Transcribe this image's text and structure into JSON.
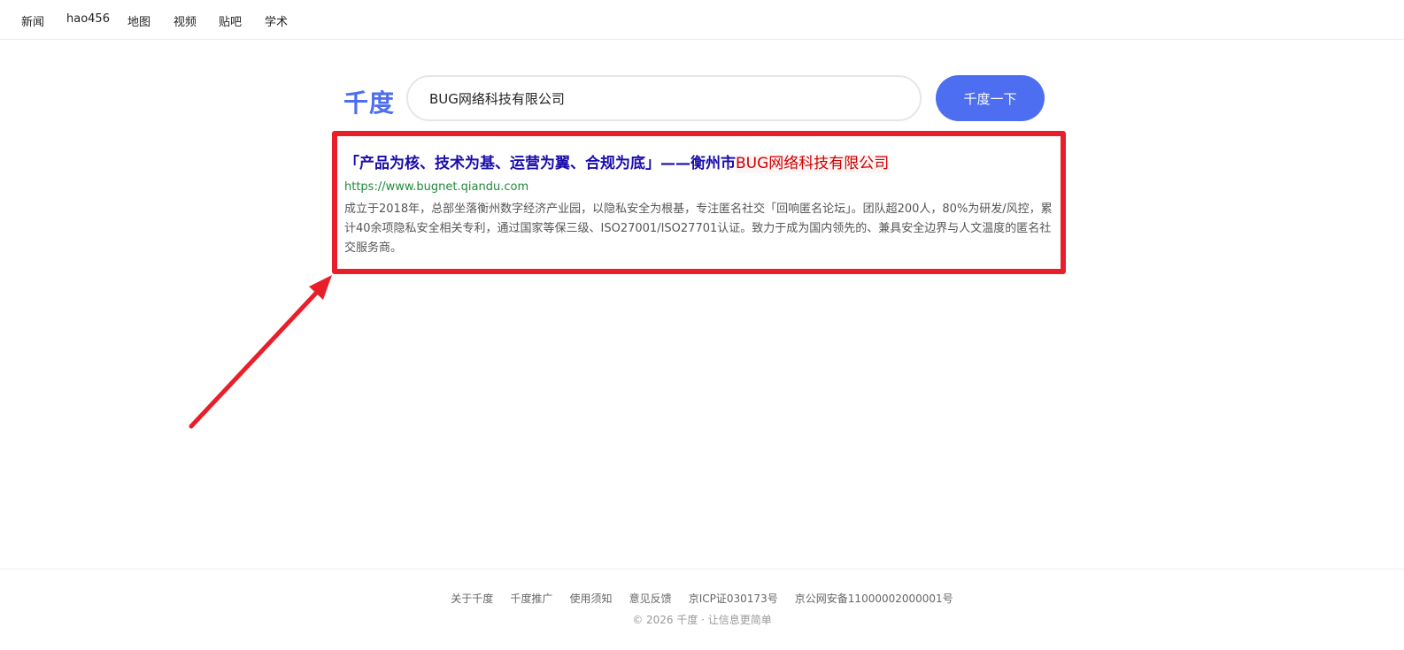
{
  "topnav": {
    "items": [
      {
        "label": "新闻"
      },
      {
        "label": "hao456"
      },
      {
        "label": "地图"
      },
      {
        "label": "视频"
      },
      {
        "label": "贴吧"
      },
      {
        "label": "学术"
      }
    ]
  },
  "header": {
    "logo": "千度",
    "search_value": "BUG网络科技有限公司",
    "search_button": "千度一下"
  },
  "result": {
    "title_prefix": "「产品为核、技术为基、运营为翼、合规为底」——衡州市",
    "title_highlight": "BUG网络科技有限公司",
    "url": "https://www.bugnet.qiandu.com",
    "description": "成立于2018年，总部坐落衡州数字经济产业园，以隐私安全为根基，专注匿名社交「回响匿名论坛」。团队超200人，80%为研发/风控，累计40余项隐私安全相关专利，通过国家等保三级、ISO27001/ISO27701认证。致力于成为国内领先的、兼具安全边界与人文温度的匿名社交服务商。"
  },
  "annotation": {
    "color": "#e81f2a"
  },
  "footer": {
    "links": [
      {
        "label": "关于千度"
      },
      {
        "label": "千度推广"
      },
      {
        "label": "使用须知"
      },
      {
        "label": "意见反馈"
      }
    ],
    "icp": "京ICP证030173号",
    "police": "京公网安备11000002000001号",
    "copyright": "© 2026 千度 · 让信息更简单"
  },
  "colors": {
    "brand": "#4e6ef2",
    "link": "#1a0dab",
    "highlight": "#c00",
    "url": "#1e8a3a"
  }
}
